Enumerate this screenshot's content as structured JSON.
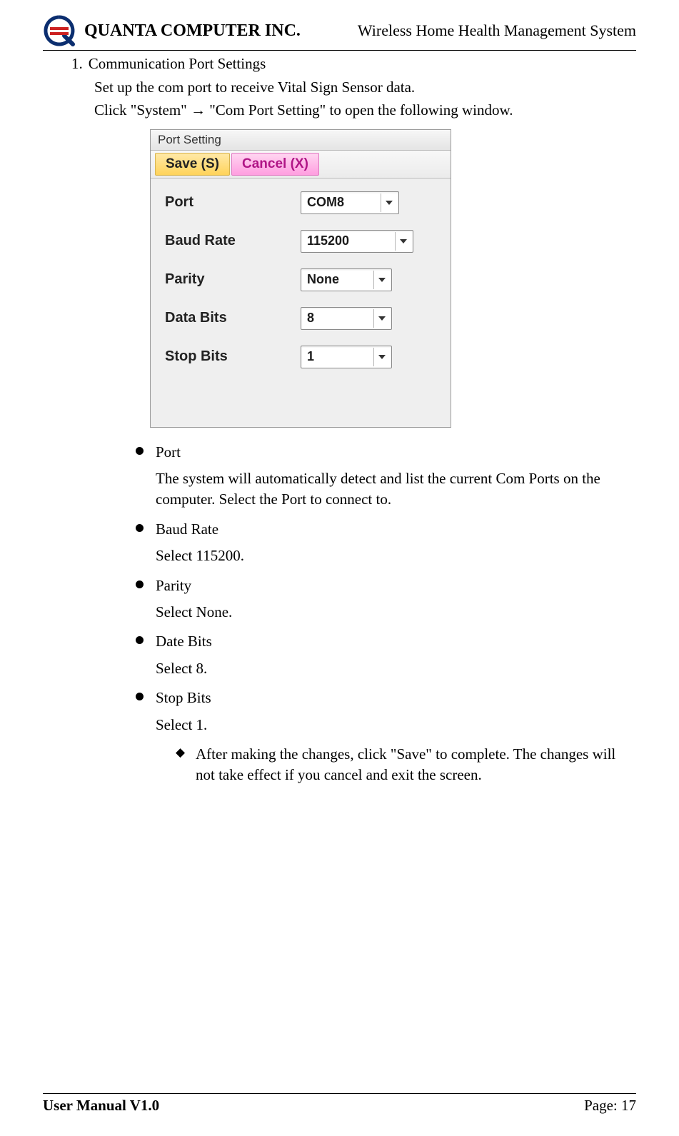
{
  "header": {
    "company": "QUANTA COMPUTER INC.",
    "doc_title": "Wireless Home Health Management System"
  },
  "section": {
    "number": "1.",
    "title": "Communication Port Settings",
    "line1": "Set up the com port to receive Vital Sign Sensor data.",
    "line2": "Click \"System\" → \"Com Port Setting\" to open the following window."
  },
  "dialog": {
    "title": "Port Setting",
    "save_label": "Save (S)",
    "cancel_label": "Cancel (X)",
    "rows": {
      "port": {
        "label": "Port",
        "value": "COM8"
      },
      "baud": {
        "label": "Baud Rate",
        "value": "115200"
      },
      "parity": {
        "label": "Parity",
        "value": "None"
      },
      "databits": {
        "label": "Data Bits",
        "value": "8"
      },
      "stopbits": {
        "label": "Stop Bits",
        "value": "1"
      }
    }
  },
  "bullets": {
    "port": {
      "title": "Port",
      "body": "The system will automatically detect and list the current Com Ports on the computer. Select the Port to connect to."
    },
    "baud": {
      "title": "Baud Rate",
      "body": "Select 115200."
    },
    "parity": {
      "title": "Parity",
      "body": "Select None."
    },
    "databits": {
      "title": "Date Bits",
      "body": "Select 8."
    },
    "stopbits": {
      "title": "Stop Bits",
      "body": "Select 1."
    },
    "note": "After making the changes, click \"Save\" to complete. The changes will not take effect if you cancel and exit the screen."
  },
  "footer": {
    "left": "User Manual V1.0",
    "right": "Page: 17"
  }
}
